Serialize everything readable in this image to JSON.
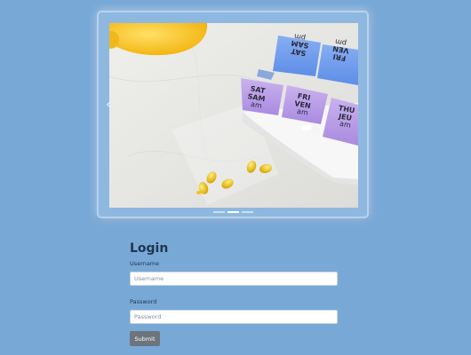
{
  "carousel": {
    "prev_icon": "chevron-left-icon",
    "indicators": [
      {
        "active": false
      },
      {
        "active": true
      },
      {
        "active": false
      }
    ],
    "image": {
      "pill_labels": [
        {
          "line1": "SAT",
          "line2": "SAM",
          "line3": "pm"
        },
        {
          "line1": "FRI",
          "line2": "VEN",
          "line3": "pm"
        },
        {
          "line1": "SAT",
          "line2": "SAM",
          "line3": "am"
        },
        {
          "line1": "FRI",
          "line2": "VEN",
          "line3": "am"
        },
        {
          "line1": "THU",
          "line2": "JEU",
          "line3": "am"
        }
      ]
    }
  },
  "login": {
    "title": "Login",
    "username_label": "Username",
    "username_placeholder": "Username",
    "username_value": "",
    "password_label": "Password",
    "password_placeholder": "Password",
    "password_value": "",
    "submit_label": "Submit"
  },
  "colors": {
    "page_background": "#78a8d6",
    "submit_button": "#6c757d",
    "title_text": "#1f3550"
  }
}
